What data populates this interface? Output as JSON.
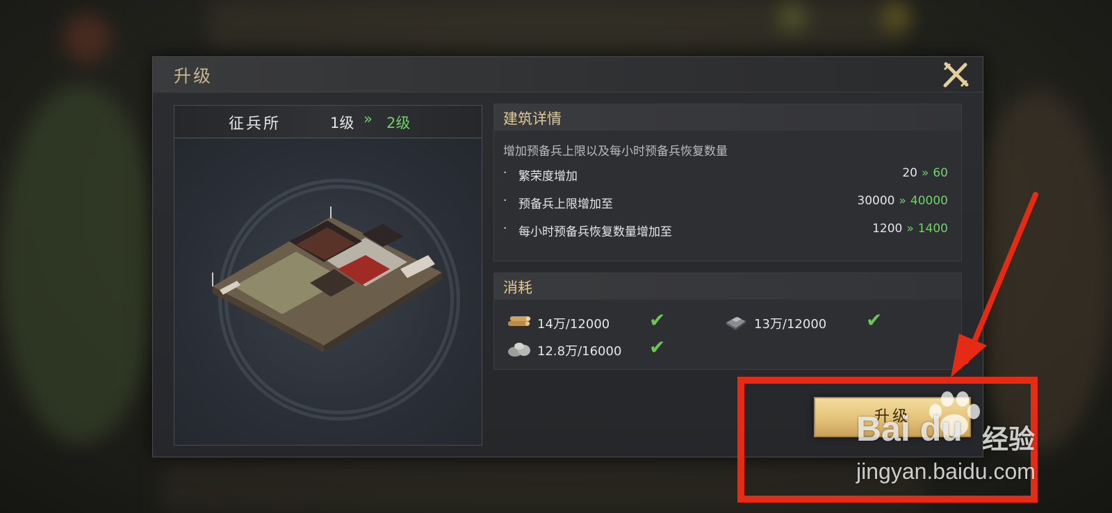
{
  "dialog": {
    "title": "升级",
    "close_icon": "close-x-icon"
  },
  "building": {
    "name": "征兵所",
    "level_from": "1级",
    "level_arrow": "»",
    "level_to": "2级"
  },
  "details": {
    "title": "建筑详情",
    "description": "增加预备兵上限以及每小时预备兵恢复数量",
    "rows": [
      {
        "label": "繁荣度增加",
        "old": "20",
        "new": "60"
      },
      {
        "label": "预备兵上限增加至",
        "old": "30000",
        "new": "40000"
      },
      {
        "label": "每小时预备兵恢复数量增加至",
        "old": "1200",
        "new": "1400"
      }
    ],
    "bullet": "·",
    "arrow": "»"
  },
  "cost": {
    "title": "消耗",
    "items": [
      {
        "icon": "wood-icon",
        "amount": "14万/12000",
        "satisfied": true
      },
      {
        "icon": "iron-icon",
        "amount": "13万/12000",
        "satisfied": true
      },
      {
        "icon": "stone-icon",
        "amount": "12.8万/16000",
        "satisfied": true
      }
    ],
    "check": "✔"
  },
  "upgrade_button": {
    "label": "升级"
  },
  "watermark": {
    "logo": "Bai du",
    "jingyan": "经验",
    "url": "jingyan.baidu.com"
  },
  "colors": {
    "accent_green": "#6fd36a",
    "title_gold": "#e0c994",
    "annotation_red": "#e62b14"
  }
}
